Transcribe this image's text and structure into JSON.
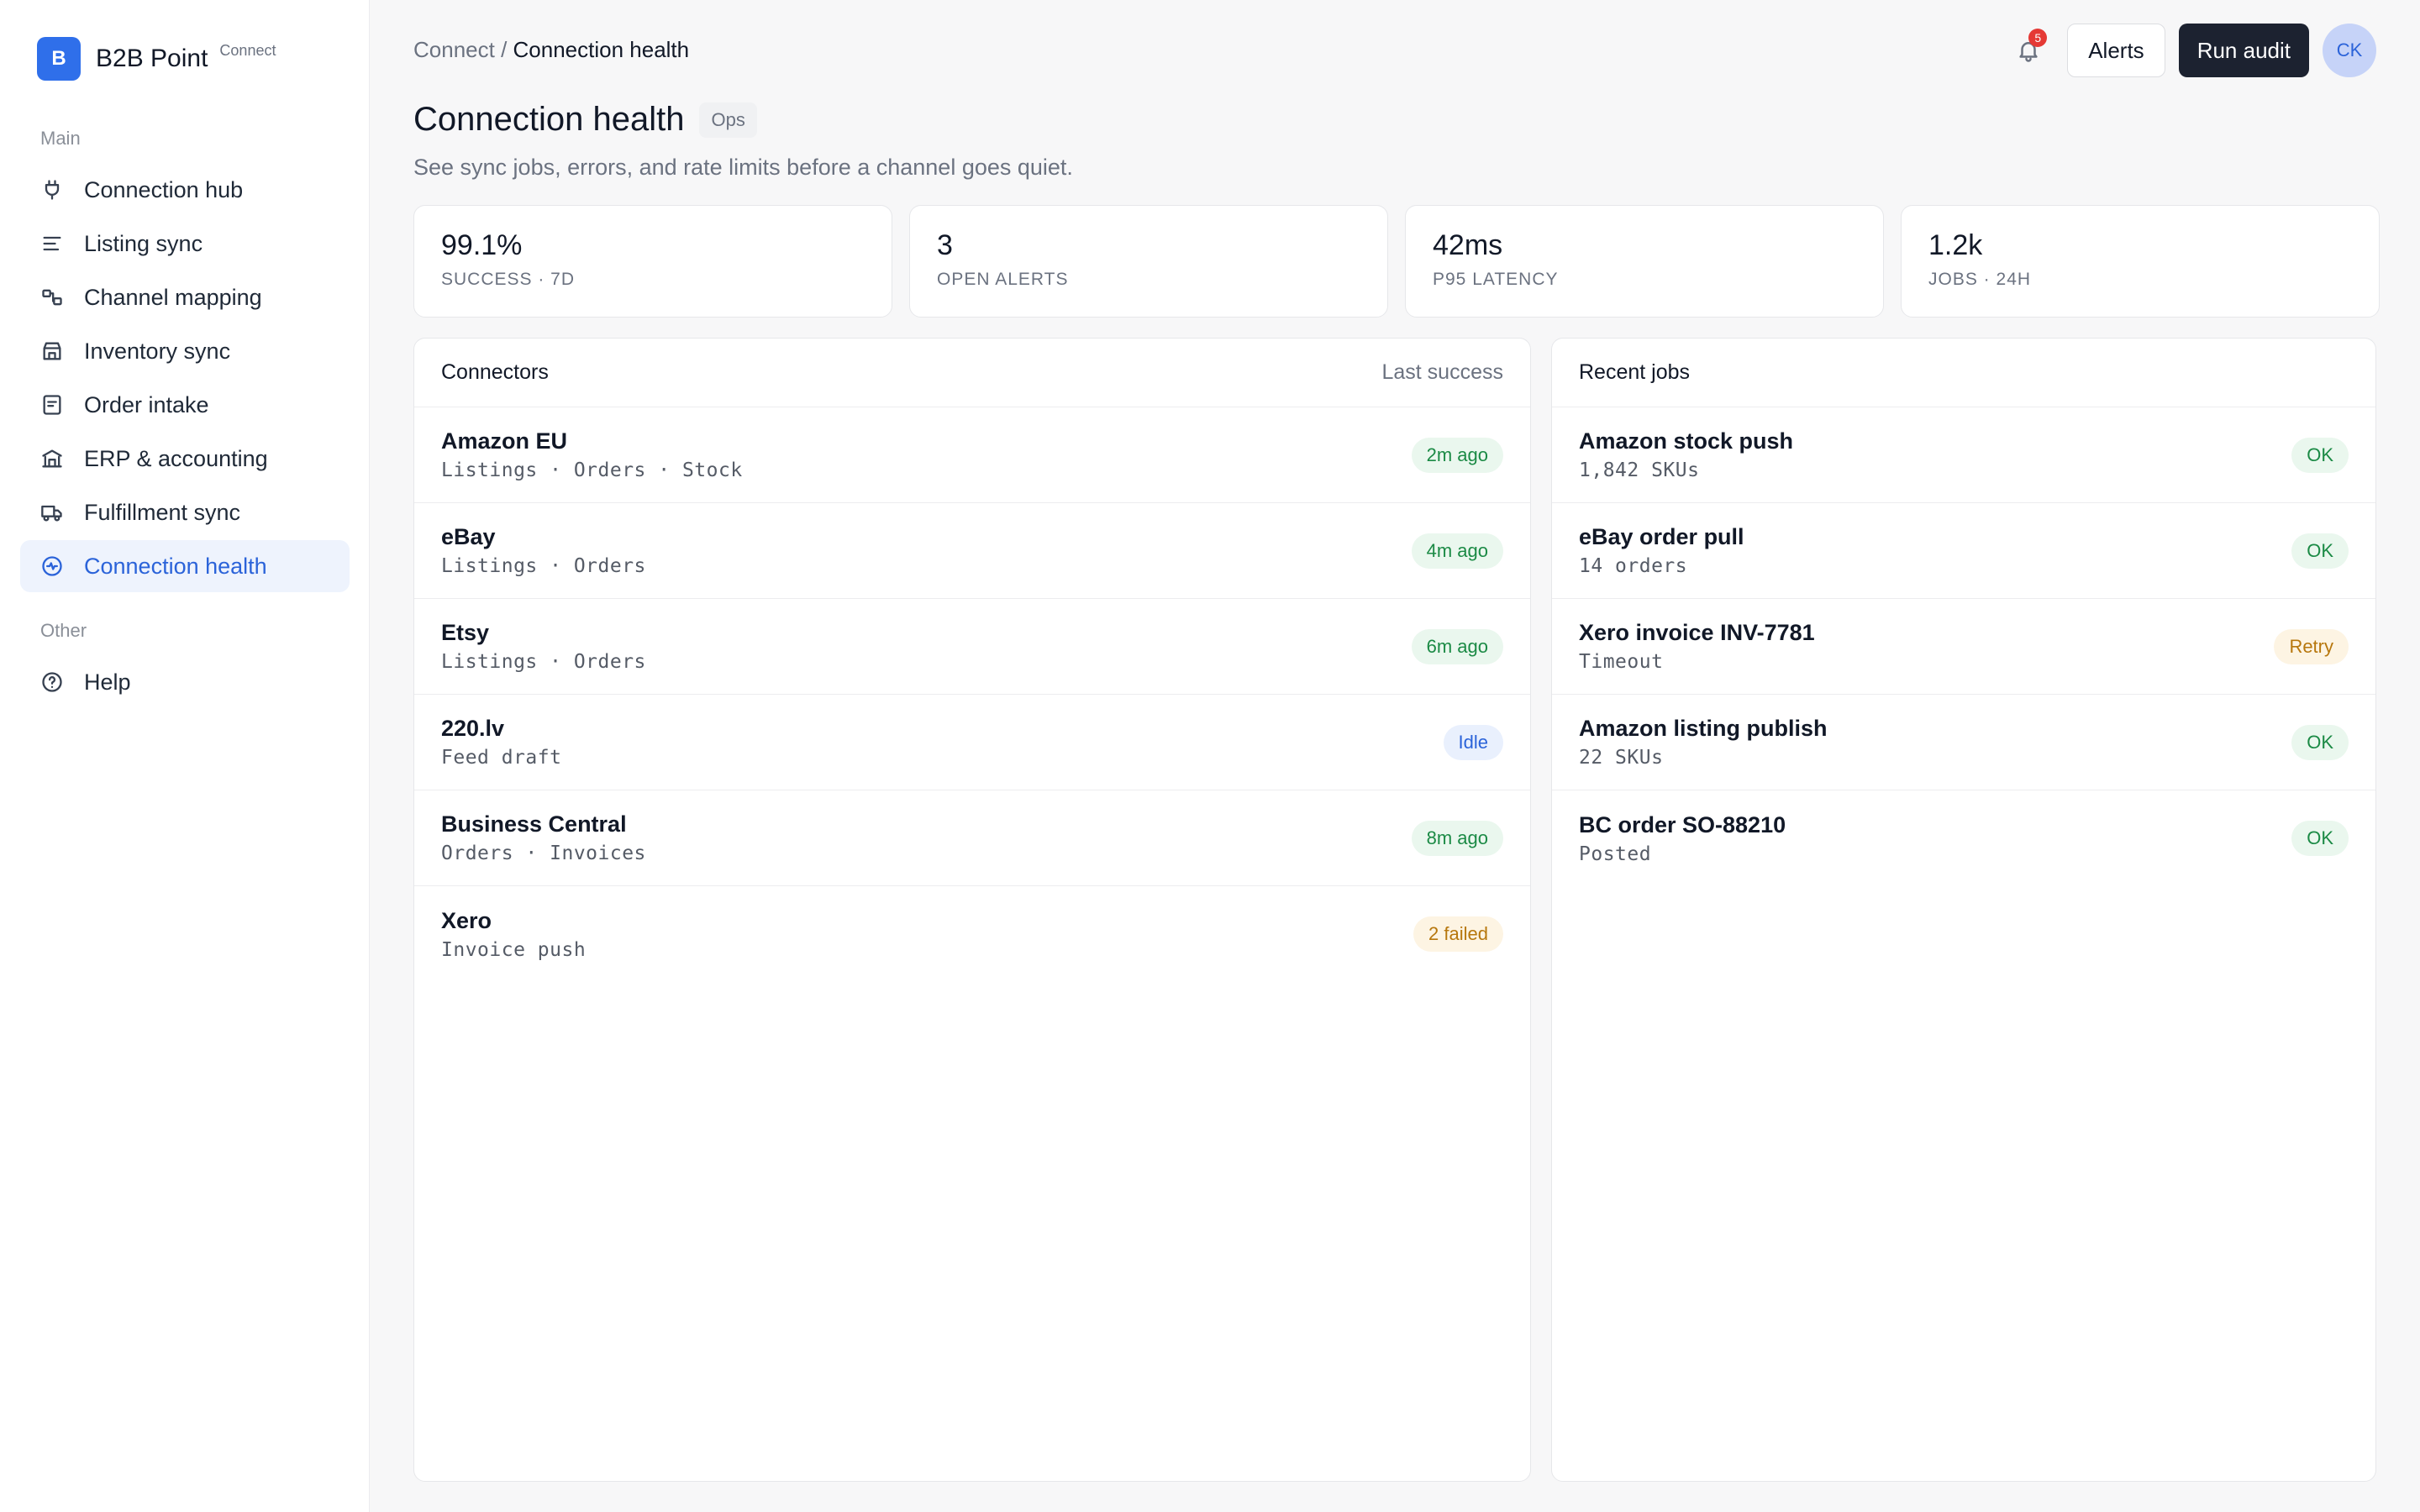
{
  "brand": {
    "logo_letter": "B",
    "name": "B2B Point",
    "tag": "Connect"
  },
  "sidebar": {
    "section_main": "Main",
    "section_other": "Other",
    "items": [
      {
        "label": "Connection hub",
        "icon": "plug-icon"
      },
      {
        "label": "Listing sync",
        "icon": "lines-icon"
      },
      {
        "label": "Channel mapping",
        "icon": "mapping-icon"
      },
      {
        "label": "Inventory sync",
        "icon": "store-icon"
      },
      {
        "label": "Order intake",
        "icon": "document-icon"
      },
      {
        "label": "ERP & accounting",
        "icon": "bank-icon"
      },
      {
        "label": "Fulfillment sync",
        "icon": "truck-icon"
      },
      {
        "label": "Connection health",
        "icon": "pulse-icon",
        "active": true
      }
    ],
    "help": {
      "label": "Help",
      "icon": "help-icon"
    }
  },
  "header": {
    "breadcrumb_parent": "Connect",
    "breadcrumb_sep": " / ",
    "breadcrumb_current": "Connection health",
    "notifications_count": "5",
    "alerts_label": "Alerts",
    "run_audit_label": "Run audit",
    "avatar_initials": "CK"
  },
  "page": {
    "title": "Connection health",
    "badge": "Ops",
    "subtitle": "See sync jobs, errors, and rate limits before a channel goes quiet."
  },
  "stats": [
    {
      "value": "99.1%",
      "label": "SUCCESS · 7D"
    },
    {
      "value": "3",
      "label": "OPEN ALERTS"
    },
    {
      "value": "42ms",
      "label": "P95 LATENCY"
    },
    {
      "value": "1.2k",
      "label": "JOBS · 24H"
    }
  ],
  "connectors": {
    "title": "Connectors",
    "side_label": "Last success",
    "rows": [
      {
        "name": "Amazon EU",
        "detail": "Listings · Orders · Stock",
        "status": "2m ago",
        "tone": "green"
      },
      {
        "name": "eBay",
        "detail": "Listings · Orders",
        "status": "4m ago",
        "tone": "green"
      },
      {
        "name": "Etsy",
        "detail": "Listings · Orders",
        "status": "6m ago",
        "tone": "green"
      },
      {
        "name": "220.lv",
        "detail": "Feed draft",
        "status": "Idle",
        "tone": "blue"
      },
      {
        "name": "Business Central",
        "detail": "Orders · Invoices",
        "status": "8m ago",
        "tone": "green"
      },
      {
        "name": "Xero",
        "detail": "Invoice push",
        "status": "2 failed",
        "tone": "amber"
      }
    ]
  },
  "jobs": {
    "title": "Recent jobs",
    "rows": [
      {
        "name": "Amazon stock push",
        "detail": "1,842 SKUs",
        "status": "OK",
        "tone": "green"
      },
      {
        "name": "eBay order pull",
        "detail": "14 orders",
        "status": "OK",
        "tone": "green"
      },
      {
        "name": "Xero invoice INV-7781",
        "detail": "Timeout",
        "status": "Retry",
        "tone": "amber"
      },
      {
        "name": "Amazon listing publish",
        "detail": "22 SKUs",
        "status": "OK",
        "tone": "green"
      },
      {
        "name": "BC order SO-88210",
        "detail": "Posted",
        "status": "OK",
        "tone": "green"
      }
    ]
  },
  "colors": {
    "accent": "#2b63d9",
    "brand": "#2f6fea",
    "primary_button": "#1c2230",
    "ok": "#1b8a45",
    "warn": "#b7770d",
    "alert_dot": "#e53935"
  }
}
